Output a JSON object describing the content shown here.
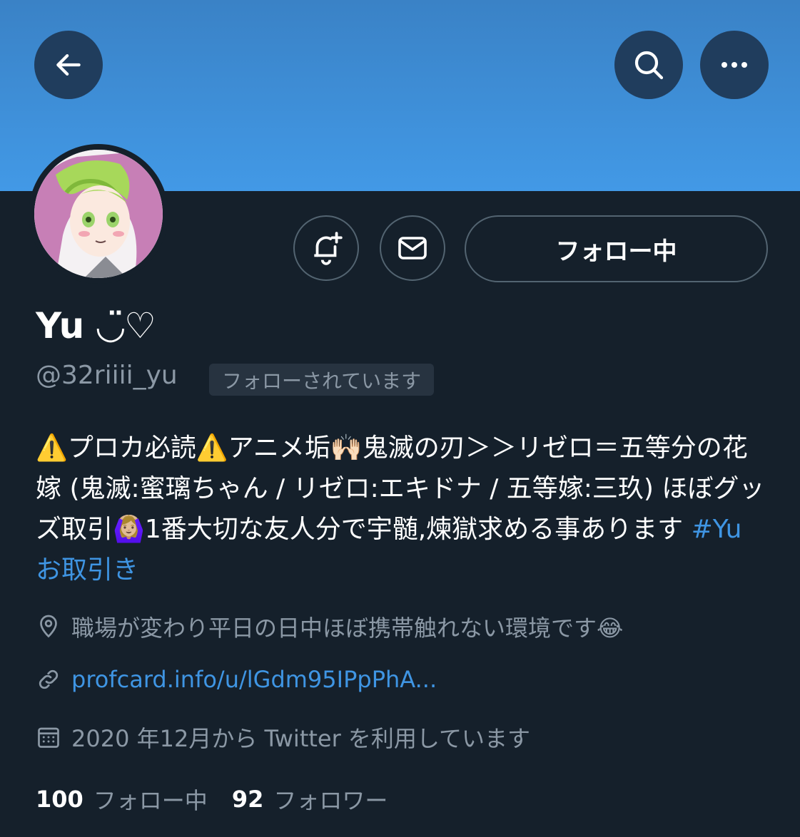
{
  "header": {
    "back_icon": "arrow-left-icon",
    "search_icon": "search-icon",
    "more_icon": "more-horizontal-icon",
    "banner_color": "#4299e6"
  },
  "profile": {
    "display_name": "Yu ◡̈♡",
    "handle": "@32riiii_yu",
    "follows_you_badge": "フォローされています",
    "follow_button_label": "フォロー中",
    "notify_icon": "bell-plus-icon",
    "message_icon": "mail-icon"
  },
  "bio": {
    "segments": [
      "⚠️プロカ必読⚠️アニメ垢🙌🏻鬼滅の刃＞＞リゼロ＝五等分の花嫁 (鬼滅:蜜璃ちゃん / リゼロ:エキドナ / 五等嫁:三玖) ほぼグッズ取引🙆🏼‍♀️1番大切な友人分で宇髄,煉獄求める事あります "
    ],
    "hashtag": "#Yu お取引き"
  },
  "meta": {
    "location": "職場が変わり平日の日中ほぼ携帯触れない環境です😂",
    "location_icon": "location-pin-icon",
    "link": "profcard.info/u/lGdm95IPpPhA...",
    "link_icon": "link-icon",
    "joined": "2020 年12月から Twitter を利用しています",
    "joined_icon": "calendar-icon"
  },
  "stats": {
    "following_count": "100",
    "following_label": "フォロー中",
    "followers_count": "92",
    "followers_label": "フォロワー"
  },
  "colors": {
    "background": "#15202b",
    "accent": "#3f95e3",
    "secondary_text": "#8b98a5"
  }
}
